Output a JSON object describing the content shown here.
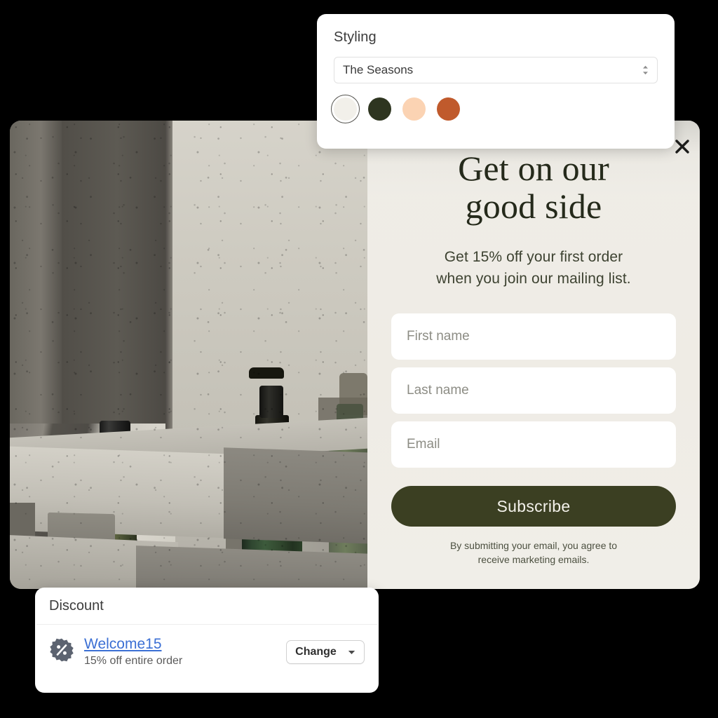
{
  "styling_panel": {
    "title": "Styling",
    "theme_select": {
      "value": "The Seasons",
      "stepper_icon": "updown-stepper-icon"
    },
    "swatches": [
      {
        "name": "swatch-offwhite",
        "color": "#F2F0EA",
        "selected": true
      },
      {
        "name": "swatch-dark-olive",
        "color": "#2E3520",
        "selected": false
      },
      {
        "name": "swatch-peach",
        "color": "#FBD3B3",
        "selected": false
      },
      {
        "name": "swatch-rust",
        "color": "#C05A2C",
        "selected": false
      }
    ]
  },
  "popup": {
    "close_icon": "close-x-icon",
    "headline": "Get on our\ngood side",
    "subheading": "Get 15% off your first order\nwhen you join our mailing list.",
    "fields": [
      {
        "name": "first-name-input",
        "placeholder": "First name",
        "value": ""
      },
      {
        "name": "last-name-input",
        "placeholder": "Last name",
        "value": ""
      },
      {
        "name": "email-input",
        "placeholder": "Email",
        "value": ""
      }
    ],
    "submit_label": "Subscribe",
    "legal_text": "By submitting your email, you agree to\nreceive marketing emails.",
    "colors": {
      "background": "#EFEDE7",
      "headline": "#252A1B",
      "button_bg": "#3B3F22",
      "button_text": "#F3F1EA"
    }
  },
  "discount_card": {
    "title": "Discount",
    "icon": "percent-badge-icon",
    "code": "Welcome15",
    "description": "15% off entire order",
    "change_button": {
      "label": "Change",
      "caret_icon": "caret-down-icon"
    },
    "colors": {
      "link": "#3B6FD4"
    }
  },
  "product_image": {
    "alt_name": "green-bottles-on-concrete-photo"
  }
}
